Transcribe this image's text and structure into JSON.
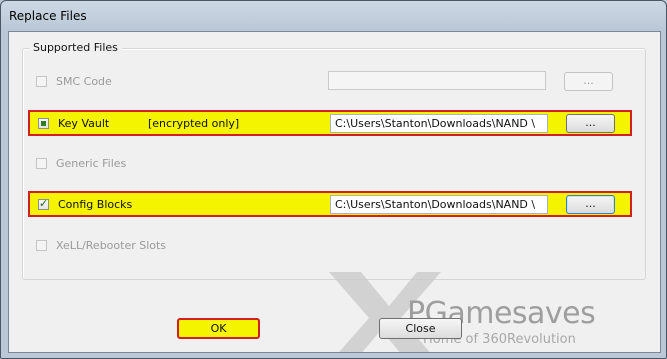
{
  "window": {
    "title": "Replace Files"
  },
  "group": {
    "label": "Supported Files"
  },
  "rows": [
    {
      "label": "SMC Code",
      "checked": false,
      "enabled": false,
      "path": "",
      "browse": "..."
    },
    {
      "label": "Key Vault",
      "note": "[encrypted only]",
      "checked": "partial",
      "enabled": true,
      "path": "C:\\Users\\Stanton\\Downloads\\NAND \\",
      "browse": "..."
    },
    {
      "label": "Generic Files",
      "checked": false,
      "enabled": false
    },
    {
      "label": "Config Blocks",
      "checked": true,
      "enabled": true,
      "path": "C:\\Users\\Stanton\\Downloads\\NAND \\",
      "browse": "..."
    },
    {
      "label": "XeLL/Rebooter Slots",
      "checked": false,
      "enabled": false
    }
  ],
  "buttons": {
    "ok": "OK",
    "close": "Close"
  },
  "watermark": {
    "brand": "PGamesaves",
    "tagline": "Home of 360Revolution"
  }
}
